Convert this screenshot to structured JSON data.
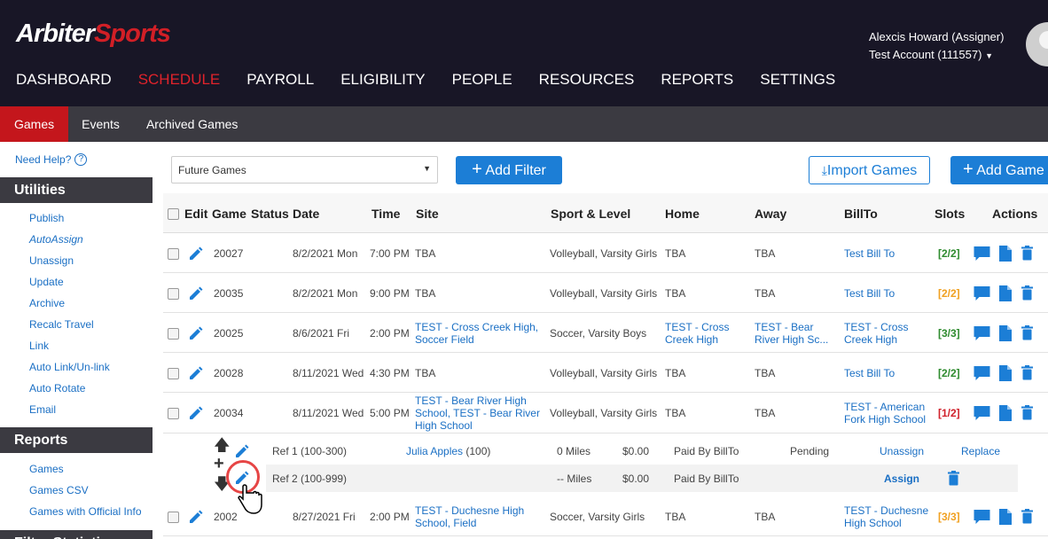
{
  "brand": {
    "name_a": "Arbiter",
    "name_b": "Sports"
  },
  "user": {
    "name": "Alexcis Howard (Assigner)",
    "account": "Test Account (111557)"
  },
  "main_nav": [
    "DASHBOARD",
    "SCHEDULE",
    "PAYROLL",
    "ELIGIBILITY",
    "PEOPLE",
    "RESOURCES",
    "REPORTS",
    "SETTINGS"
  ],
  "sub_nav": [
    "Games",
    "Events",
    "Archived Games"
  ],
  "sidebar": {
    "help": "Need Help?",
    "utilities_title": "Utilities",
    "utilities": [
      "Publish",
      "AutoAssign",
      "Unassign",
      "Update",
      "Archive",
      "Recalc Travel",
      "Link",
      "Auto Link/Un-link",
      "Auto Rotate",
      "Email"
    ],
    "reports_title": "Reports",
    "reports": [
      "Games",
      "Games CSV",
      "Games with Official Info"
    ],
    "next_title": "Filter Statistics"
  },
  "toolbar": {
    "filter_value": "Future Games",
    "add_filter": "Add Filter",
    "import": "Import Games",
    "add_game": "Add Game"
  },
  "columns": [
    "Edit",
    "Game",
    "Status",
    "Date",
    "Time",
    "Site",
    "Sport & Level",
    "Home",
    "Away",
    "BillTo",
    "Slots",
    "Actions"
  ],
  "games": [
    {
      "game": "20027",
      "date": "8/2/2021 Mon",
      "time": "7:00 PM",
      "site": [
        "TBA"
      ],
      "site_link": false,
      "sport": "Volleyball, Varsity Girls",
      "home": [
        "TBA"
      ],
      "home_link": false,
      "away": [
        "TBA"
      ],
      "away_link": false,
      "billto": [
        "Test Bill To"
      ],
      "slots": "[2/2]",
      "slot_color": "#2e8b2e"
    },
    {
      "game": "20035",
      "date": "8/2/2021 Mon",
      "time": "9:00 PM",
      "site": [
        "TBA"
      ],
      "site_link": false,
      "sport": "Volleyball, Varsity Girls",
      "home": [
        "TBA"
      ],
      "home_link": false,
      "away": [
        "TBA"
      ],
      "away_link": false,
      "billto": [
        "Test Bill To"
      ],
      "slots": "[2/2]",
      "slot_color": "#f0a020"
    },
    {
      "game": "20025",
      "date": "8/6/2021 Fri",
      "time": "2:00 PM",
      "site": [
        "TEST - Cross Creek High,",
        "Soccer Field"
      ],
      "site_link": true,
      "sport": "Soccer, Varsity Boys",
      "home": [
        "TEST - Cross",
        "Creek High"
      ],
      "home_link": true,
      "away": [
        "TEST - Bear",
        "River High Sc..."
      ],
      "away_link": true,
      "billto": [
        "TEST - Cross",
        "Creek High"
      ],
      "slots": "[3/3]",
      "slot_color": "#2e8b2e"
    },
    {
      "game": "20028",
      "date": "8/11/2021 Wed",
      "time": "4:30 PM",
      "site": [
        "TBA"
      ],
      "site_link": false,
      "sport": "Volleyball, Varsity Girls",
      "home": [
        "TBA"
      ],
      "home_link": false,
      "away": [
        "TBA"
      ],
      "away_link": false,
      "billto": [
        "Test Bill To"
      ],
      "slots": "[2/2]",
      "slot_color": "#2e8b2e"
    },
    {
      "game": "20034",
      "date": "8/11/2021 Wed",
      "time": "5:00 PM",
      "site": [
        "TEST - Bear River High",
        "School, TEST - Bear River",
        "High School"
      ],
      "site_link": true,
      "sport": "Volleyball, Varsity Girls",
      "home": [
        "TBA"
      ],
      "home_link": false,
      "away": [
        "TBA"
      ],
      "away_link": false,
      "billto": [
        "TEST - American",
        "Fork High School"
      ],
      "slots": "[1/2]",
      "slot_color": "#d0202a"
    },
    {
      "game": "2002",
      "date": "8/27/2021 Fri",
      "time": "2:00 PM",
      "site": [
        "TEST - Duchesne High",
        "School, Field"
      ],
      "site_link": true,
      "sport": "Soccer, Varsity Girls",
      "home": [
        "TBA"
      ],
      "home_link": false,
      "away": [
        "TBA"
      ],
      "away_link": false,
      "billto": [
        "TEST - Duchesne",
        "High School"
      ],
      "slots": "[3/3]",
      "slot_color": "#f0a020"
    }
  ],
  "slot_rows": [
    {
      "position": "Ref 1 (100-300)",
      "official": "Julia Apples",
      "official_id": "(100)",
      "miles": "0 Miles",
      "fee": "$0.00",
      "paid_by": "Paid By BillTo",
      "status": "Pending",
      "action1": "Unassign",
      "action2": "Replace"
    },
    {
      "position": "Ref 2 (100-999)",
      "official": "",
      "official_id": "",
      "miles": "-- Miles",
      "fee": "$0.00",
      "paid_by": "Paid By BillTo",
      "status": "",
      "action1": "Assign",
      "action2": ""
    }
  ],
  "colors": {
    "header_bg": "#181626",
    "subnav_bg": "#3b3a41",
    "accent_red": "#c4161c",
    "link_blue": "#1a6fc4",
    "button_blue": "#1c7ed6"
  }
}
